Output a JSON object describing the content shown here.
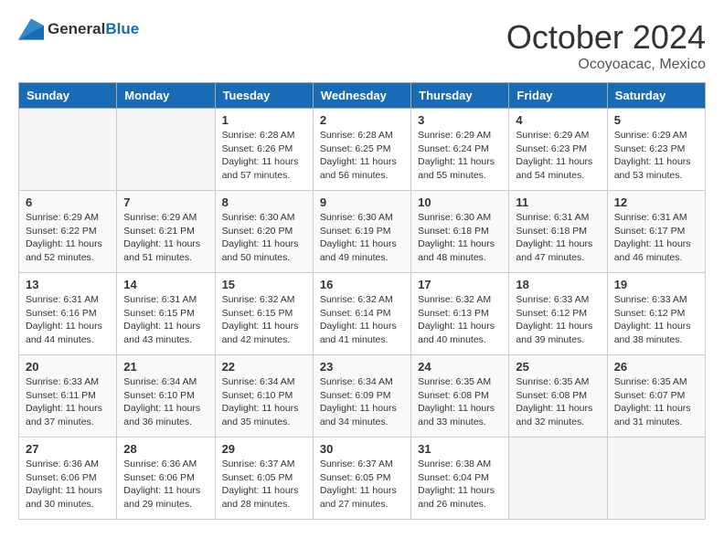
{
  "header": {
    "logo_general": "General",
    "logo_blue": "Blue",
    "month": "October 2024",
    "location": "Ocoyoacac, Mexico"
  },
  "days_of_week": [
    "Sunday",
    "Monday",
    "Tuesday",
    "Wednesday",
    "Thursday",
    "Friday",
    "Saturday"
  ],
  "weeks": [
    [
      {
        "day": "",
        "info": "",
        "empty": true
      },
      {
        "day": "",
        "info": "",
        "empty": true
      },
      {
        "day": "1",
        "info": "Sunrise: 6:28 AM\nSunset: 6:26 PM\nDaylight: 11 hours and 57 minutes."
      },
      {
        "day": "2",
        "info": "Sunrise: 6:28 AM\nSunset: 6:25 PM\nDaylight: 11 hours and 56 minutes."
      },
      {
        "day": "3",
        "info": "Sunrise: 6:29 AM\nSunset: 6:24 PM\nDaylight: 11 hours and 55 minutes."
      },
      {
        "day": "4",
        "info": "Sunrise: 6:29 AM\nSunset: 6:23 PM\nDaylight: 11 hours and 54 minutes."
      },
      {
        "day": "5",
        "info": "Sunrise: 6:29 AM\nSunset: 6:23 PM\nDaylight: 11 hours and 53 minutes."
      }
    ],
    [
      {
        "day": "6",
        "info": "Sunrise: 6:29 AM\nSunset: 6:22 PM\nDaylight: 11 hours and 52 minutes."
      },
      {
        "day": "7",
        "info": "Sunrise: 6:29 AM\nSunset: 6:21 PM\nDaylight: 11 hours and 51 minutes."
      },
      {
        "day": "8",
        "info": "Sunrise: 6:30 AM\nSunset: 6:20 PM\nDaylight: 11 hours and 50 minutes."
      },
      {
        "day": "9",
        "info": "Sunrise: 6:30 AM\nSunset: 6:19 PM\nDaylight: 11 hours and 49 minutes."
      },
      {
        "day": "10",
        "info": "Sunrise: 6:30 AM\nSunset: 6:18 PM\nDaylight: 11 hours and 48 minutes."
      },
      {
        "day": "11",
        "info": "Sunrise: 6:31 AM\nSunset: 6:18 PM\nDaylight: 11 hours and 47 minutes."
      },
      {
        "day": "12",
        "info": "Sunrise: 6:31 AM\nSunset: 6:17 PM\nDaylight: 11 hours and 46 minutes."
      }
    ],
    [
      {
        "day": "13",
        "info": "Sunrise: 6:31 AM\nSunset: 6:16 PM\nDaylight: 11 hours and 44 minutes."
      },
      {
        "day": "14",
        "info": "Sunrise: 6:31 AM\nSunset: 6:15 PM\nDaylight: 11 hours and 43 minutes."
      },
      {
        "day": "15",
        "info": "Sunrise: 6:32 AM\nSunset: 6:15 PM\nDaylight: 11 hours and 42 minutes."
      },
      {
        "day": "16",
        "info": "Sunrise: 6:32 AM\nSunset: 6:14 PM\nDaylight: 11 hours and 41 minutes."
      },
      {
        "day": "17",
        "info": "Sunrise: 6:32 AM\nSunset: 6:13 PM\nDaylight: 11 hours and 40 minutes."
      },
      {
        "day": "18",
        "info": "Sunrise: 6:33 AM\nSunset: 6:12 PM\nDaylight: 11 hours and 39 minutes."
      },
      {
        "day": "19",
        "info": "Sunrise: 6:33 AM\nSunset: 6:12 PM\nDaylight: 11 hours and 38 minutes."
      }
    ],
    [
      {
        "day": "20",
        "info": "Sunrise: 6:33 AM\nSunset: 6:11 PM\nDaylight: 11 hours and 37 minutes."
      },
      {
        "day": "21",
        "info": "Sunrise: 6:34 AM\nSunset: 6:10 PM\nDaylight: 11 hours and 36 minutes."
      },
      {
        "day": "22",
        "info": "Sunrise: 6:34 AM\nSunset: 6:10 PM\nDaylight: 11 hours and 35 minutes."
      },
      {
        "day": "23",
        "info": "Sunrise: 6:34 AM\nSunset: 6:09 PM\nDaylight: 11 hours and 34 minutes."
      },
      {
        "day": "24",
        "info": "Sunrise: 6:35 AM\nSunset: 6:08 PM\nDaylight: 11 hours and 33 minutes."
      },
      {
        "day": "25",
        "info": "Sunrise: 6:35 AM\nSunset: 6:08 PM\nDaylight: 11 hours and 32 minutes."
      },
      {
        "day": "26",
        "info": "Sunrise: 6:35 AM\nSunset: 6:07 PM\nDaylight: 11 hours and 31 minutes."
      }
    ],
    [
      {
        "day": "27",
        "info": "Sunrise: 6:36 AM\nSunset: 6:06 PM\nDaylight: 11 hours and 30 minutes."
      },
      {
        "day": "28",
        "info": "Sunrise: 6:36 AM\nSunset: 6:06 PM\nDaylight: 11 hours and 29 minutes."
      },
      {
        "day": "29",
        "info": "Sunrise: 6:37 AM\nSunset: 6:05 PM\nDaylight: 11 hours and 28 minutes."
      },
      {
        "day": "30",
        "info": "Sunrise: 6:37 AM\nSunset: 6:05 PM\nDaylight: 11 hours and 27 minutes."
      },
      {
        "day": "31",
        "info": "Sunrise: 6:38 AM\nSunset: 6:04 PM\nDaylight: 11 hours and 26 minutes."
      },
      {
        "day": "",
        "info": "",
        "empty": true
      },
      {
        "day": "",
        "info": "",
        "empty": true
      }
    ]
  ]
}
